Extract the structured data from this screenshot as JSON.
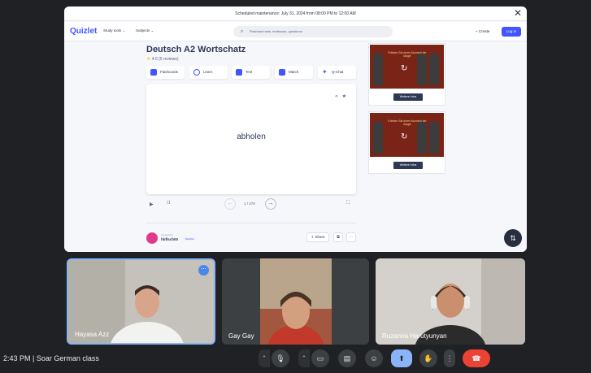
{
  "quizlet": {
    "maintenance_text": "Scheduled maintenance: July 31, 2024 from 08:00 PM to 12:00 AM",
    "logo": "Quizlet",
    "nav_study_tools": "Study tools ⌄",
    "nav_subjects": "Subjects ⌄",
    "search_placeholder": "Flashcard sets, textbooks, questions",
    "create_label": "+ Create",
    "login_label": "Log in",
    "set_title": "Deutsch A2 Wortschatz",
    "rating": "4.6 (5 reviews)",
    "modes": [
      {
        "label": "Flashcards",
        "color": "#4255ff"
      },
      {
        "label": "Learn",
        "color": "#4255ff"
      },
      {
        "label": "Test",
        "color": "#4255ff"
      },
      {
        "label": "Match",
        "color": "#4255ff"
      },
      {
        "label": "Q-Chat",
        "color": "#98e3ff"
      }
    ],
    "card_word": "abholen",
    "card_counter": "1 / 270",
    "created_by": "Created by",
    "creator_name": "hbflsch00",
    "creator_badge": "Teacher",
    "share_label": "Share",
    "ad_text": "Erleben Sie einen Moment der Magie",
    "ad_button": "Weitere Infos"
  },
  "participants": [
    {
      "name": "Hayasa Azz"
    },
    {
      "name": "Gay Gay"
    },
    {
      "name": "Ruzanna Harutyunyan"
    }
  ],
  "meeting": {
    "time_and_title": "2:43 PM  |  Soar German class"
  },
  "colors": {
    "brand": "#4255ff",
    "meet_bg": "#202124",
    "end_call": "#ea4335",
    "active_tile_border": "#8ab4f8"
  }
}
